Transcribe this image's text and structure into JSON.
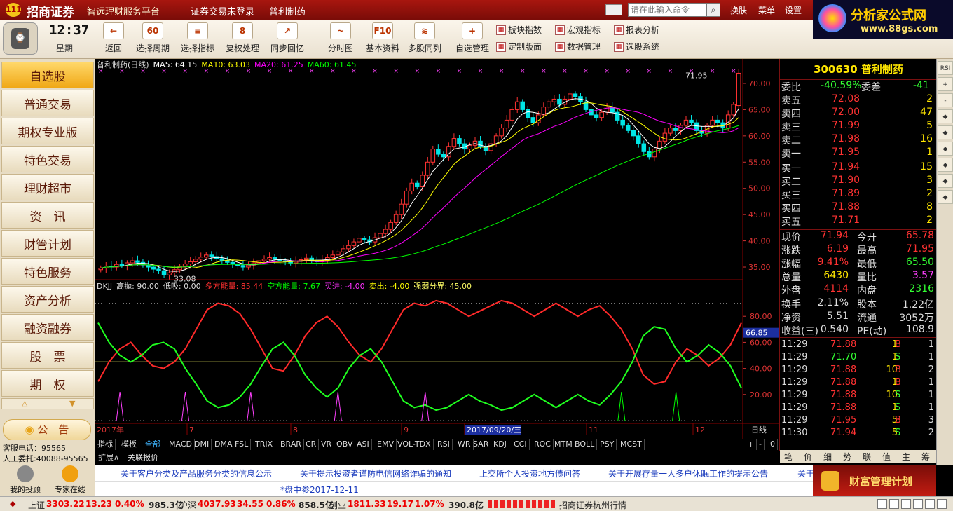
{
  "title": {
    "brand": "招商证券",
    "subtitle": "智远理财服务平台",
    "login": "证券交易未登录",
    "stock": "普利制药",
    "cmd_placeholder": "请在此输入命令",
    "menu": [
      "换肤",
      "菜单",
      "设置"
    ],
    "ad": "分析家公式网",
    "ad_url": "www.88gs.com"
  },
  "clock": {
    "time": "12:37",
    "weekday": "星期一"
  },
  "toolbar": [
    {
      "label": "返回",
      "icon": "←"
    },
    {
      "label": "选择周期",
      "icon": "60"
    },
    {
      "label": "选择指标",
      "icon": "≡"
    },
    {
      "label": "复权处理",
      "icon": "8"
    },
    {
      "label": "同步回忆",
      "icon": "↗"
    },
    {
      "label": "分时图",
      "icon": "~"
    },
    {
      "label": "基本资料",
      "icon": "F10"
    },
    {
      "label": "多股同列",
      "icon": "≋"
    },
    {
      "label": "自选管理",
      "icon": "+"
    }
  ],
  "toolbar2": [
    {
      "label": "板块指数"
    },
    {
      "label": "宏观指标"
    },
    {
      "label": "报表分析"
    },
    {
      "label": "定制版面"
    },
    {
      "label": "数据管理"
    },
    {
      "label": "选股系统"
    }
  ],
  "sidebar": {
    "items": [
      "自选股",
      "普通交易",
      "期权专业版",
      "特色交易",
      "理财超市",
      "资　讯",
      "财管计划",
      "特色服务",
      "资产分析",
      "融资融券",
      "股　票",
      "期　权"
    ],
    "notice": "公　告",
    "phone": "客服电话：95565",
    "agent": "人工委托:40088-95565",
    "bottom": [
      "我的投顾",
      "专家在线"
    ]
  },
  "chart_data": [
    {
      "type": "candlestick",
      "title": "普利制药(日线)",
      "ma": [
        {
          "name": "MA5",
          "value": "64.15",
          "color": "#ffffff"
        },
        {
          "name": "MA10",
          "value": "63.03",
          "color": "#ffff00"
        },
        {
          "name": "MA20",
          "value": "61.25",
          "color": "#ff00ff"
        },
        {
          "name": "MA60",
          "value": "61.45",
          "color": "#00ff00"
        }
      ],
      "ylim": [
        33,
        72
      ],
      "yticks": [
        "70.00",
        "65.00",
        "60.00",
        "55.00",
        "50.00",
        "45.00",
        "40.00",
        "35.00"
      ],
      "high_label": "71.95",
      "low_label": "33.08",
      "closes": [
        34.8,
        35.2,
        35.0,
        35.5,
        35.3,
        35.8,
        36.2,
        35.9,
        35.4,
        35.0,
        34.6,
        34.3,
        33.5,
        33.9,
        34.5,
        35.1,
        35.6,
        36.0,
        36.5,
        36.9,
        37.3,
        37.0,
        36.6,
        36.2,
        35.9,
        35.6,
        35.3,
        35.0,
        35.4,
        35.8,
        36.2,
        36.5,
        36.8,
        36.5,
        36.2,
        36.0,
        35.8,
        36.1,
        36.4,
        36.7,
        36.3,
        36.0,
        36.3,
        36.8,
        37.3,
        37.9,
        38.5,
        39.1,
        39.8,
        40.5,
        40.2,
        39.8,
        40.6,
        41.4,
        42.2,
        43.5,
        45.0,
        47.0,
        49.5,
        51.0,
        50.3,
        52.5,
        55.0,
        57.5,
        56.5,
        56.0,
        58.0,
        59.5,
        58.5,
        57.5,
        58.2,
        59.0,
        58.0,
        57.2,
        58.5,
        60.0,
        61.5,
        63.0,
        65.0,
        66.5,
        65.0,
        63.5,
        62.5,
        64.0,
        65.5,
        66.5,
        67.0,
        66.0,
        67.0,
        68.0,
        67.5,
        66.5,
        65.0,
        64.0,
        63.5,
        64.5,
        65.5,
        64.5,
        63.0,
        62.0,
        61.0,
        60.0,
        58.5,
        57.0,
        56.0,
        57.5,
        59.0,
        60.5,
        61.5,
        61.0,
        62.0,
        63.0,
        62.5,
        61.0,
        60.5,
        62.0,
        63.0,
        62.5,
        61.5,
        64.0,
        66.0,
        71.94
      ]
    },
    {
      "type": "line",
      "title": "DKJJ",
      "params": [
        {
          "name": "高抛",
          "value": "90.00",
          "color": "#dddddd"
        },
        {
          "name": "低吸",
          "value": "0.00",
          "color": "#dddddd"
        },
        {
          "name": "多方能量",
          "value": "85.44",
          "color": "#ff3030"
        },
        {
          "name": "空方能量",
          "value": "7.67",
          "color": "#00ff00"
        },
        {
          "name": "买进",
          "value": "-4.00",
          "color": "#ff30ff"
        },
        {
          "name": "卖出",
          "value": "-4.00",
          "color": "#ffff00"
        },
        {
          "name": "强弱分界",
          "value": "45.00",
          "color": "#ffff66"
        }
      ],
      "ylim": [
        0,
        100
      ],
      "yticks": [
        "80.00",
        "60.00",
        "40.00",
        "20.00"
      ],
      "current": "66.85",
      "long_energy": [
        30,
        45,
        55,
        60,
        50,
        42,
        40,
        45,
        55,
        70,
        85,
        90,
        88,
        82,
        70,
        55,
        40,
        38,
        50,
        65,
        75,
        80,
        72,
        60,
        50,
        45,
        55,
        70,
        85,
        90,
        88,
        92,
        90,
        85,
        80,
        84,
        88,
        92,
        90,
        85,
        80,
        85,
        90,
        85,
        80,
        85,
        88,
        80,
        70,
        55,
        35,
        28,
        30,
        45,
        55,
        50,
        42,
        48,
        58,
        75
      ],
      "short_energy": [
        75,
        60,
        50,
        45,
        50,
        58,
        60,
        55,
        40,
        28,
        15,
        10,
        12,
        18,
        28,
        42,
        55,
        60,
        50,
        35,
        25,
        18,
        25,
        40,
        50,
        55,
        45,
        30,
        15,
        10,
        12,
        8,
        10,
        15,
        20,
        15,
        12,
        8,
        10,
        15,
        20,
        15,
        10,
        15,
        20,
        15,
        12,
        20,
        30,
        45,
        65,
        72,
        70,
        55,
        45,
        50,
        58,
        52,
        42,
        25
      ],
      "markers": [
        1,
        4,
        7,
        14,
        17
      ]
    }
  ],
  "xaxis": {
    "labels": [
      "2017年",
      "7",
      "8",
      "9",
      "2017/09/20/三",
      "11",
      "12"
    ],
    "right": "日线"
  },
  "indicator_tabs": [
    "指标",
    "模板",
    "全部",
    "MACD",
    "DMI",
    "DMA",
    "FSL",
    "TRIX",
    "BRAR",
    "CR",
    "VR",
    "OBV",
    "ASI",
    "EMV",
    "VOL-TDX",
    "RSI",
    "WR",
    "SAR",
    "KDJ",
    "CCI",
    "ROC",
    "MTM",
    "BOLL",
    "PSY",
    "MCST"
  ],
  "expand_tabs": [
    "扩展∧",
    "关联报价"
  ],
  "quote": {
    "header": "300630 普利制药",
    "weibi": {
      "label": "委比",
      "value": "-40.59%",
      "label2": "委差",
      "value2": "-41"
    },
    "sells": [
      {
        "label": "卖五",
        "price": "72.08",
        "vol": "2"
      },
      {
        "label": "卖四",
        "price": "72.00",
        "vol": "47"
      },
      {
        "label": "卖三",
        "price": "71.99",
        "vol": "5"
      },
      {
        "label": "卖二",
        "price": "71.98",
        "vol": "16"
      },
      {
        "label": "卖一",
        "price": "71.95",
        "vol": "1"
      }
    ],
    "buys": [
      {
        "label": "买一",
        "price": "71.94",
        "vol": "15"
      },
      {
        "label": "买二",
        "price": "71.90",
        "vol": "3"
      },
      {
        "label": "买三",
        "price": "71.89",
        "vol": "2"
      },
      {
        "label": "买四",
        "price": "71.88",
        "vol": "8"
      },
      {
        "label": "买五",
        "price": "71.71",
        "vol": "2"
      }
    ],
    "stats": [
      [
        "现价",
        "71.94",
        "今开",
        "65.78"
      ],
      [
        "涨跌",
        "6.19",
        "最高",
        "71.95"
      ],
      [
        "涨幅",
        "9.41%",
        "最低",
        "65.50"
      ],
      [
        "总量",
        "6430",
        "量比",
        "3.57"
      ],
      [
        "外盘",
        "4114",
        "内盘",
        "2316"
      ]
    ],
    "stats2": [
      [
        "换手",
        "2.11%",
        "股本",
        "1.22亿"
      ],
      [
        "净资",
        "5.51",
        "流通",
        "3052万"
      ],
      [
        "收益(三)",
        "0.540",
        "PE(动)",
        "108.9"
      ]
    ],
    "ticks": [
      [
        "11:29",
        "71.88",
        "1",
        "B",
        "1"
      ],
      [
        "11:29",
        "71.70",
        "1",
        "S",
        "1"
      ],
      [
        "11:29",
        "71.88",
        "10",
        "B",
        "2"
      ],
      [
        "11:29",
        "71.88",
        "1",
        "B",
        "1"
      ],
      [
        "11:29",
        "71.88",
        "10",
        "S",
        "1"
      ],
      [
        "11:29",
        "71.88",
        "1",
        "S",
        "1"
      ],
      [
        "11:29",
        "71.95",
        "5",
        "B",
        "3"
      ],
      [
        "11:30",
        "71.94",
        "5",
        "S",
        "2"
      ]
    ],
    "bottom_tabs": [
      "笔",
      "价",
      "细",
      "势",
      "联",
      "值",
      "主",
      "筹"
    ]
  },
  "right_strip": [
    "RSI",
    "+",
    "-",
    "◆",
    "◆",
    "◆",
    "◆",
    "◆",
    "◆"
  ],
  "news": [
    "关于客户分类及产品服务分类的信息公示",
    "关于提示投资者谨防电信网络诈骗的通知",
    "上交所个人投资地方债问答",
    "关于开展存量一人多户休眠工作的提示公告",
    "关于"
  ],
  "news_sub": "*盘中参2017-12-11",
  "wealth": "财富管理计划",
  "status": {
    "sh_label": "上证",
    "sh": "3303.22",
    "sh_ch": "13.23",
    "sh_pct": "0.40%",
    "sh_amt": "985.3亿",
    "sz_label": "沪深",
    "sz": "4037.93",
    "sz_ch": "34.55",
    "sz_pct": "0.86%",
    "sz_amt": "858.5亿",
    "cy_label": "创业",
    "cy": "1811.33",
    "cy_ch": "19.17",
    "cy_pct": "1.07%",
    "cy_amt": "390.8亿",
    "server": "招商证券杭州行情"
  }
}
